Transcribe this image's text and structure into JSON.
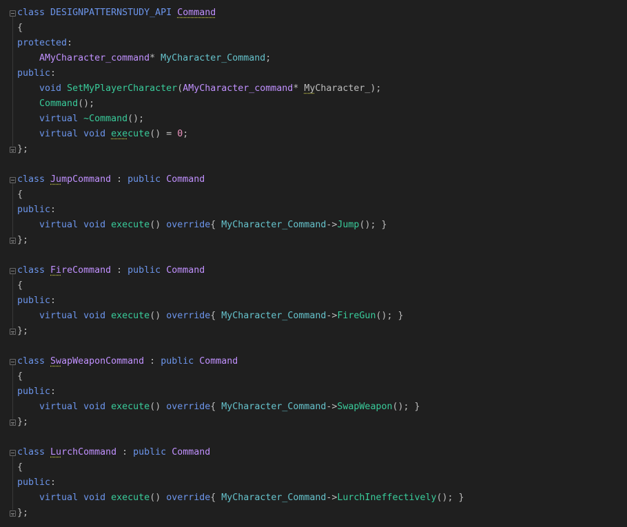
{
  "code": {
    "language": "C++",
    "lines": [
      [
        {
          "t": "class",
          "c": "kw"
        },
        {
          "t": " ",
          "c": "pn"
        },
        {
          "t": "DESIGNPATTERNSTUDY_API",
          "c": "macro"
        },
        {
          "t": " ",
          "c": "pn"
        },
        {
          "t": "Command",
          "c": "cls",
          "sq": 1
        }
      ],
      [
        {
          "t": "{",
          "c": "pn"
        }
      ],
      [
        {
          "t": "protected",
          "c": "kw"
        },
        {
          "t": ":",
          "c": "pn"
        }
      ],
      [
        {
          "t": "    ",
          "c": "pn"
        },
        {
          "t": "AMyCharacter_command",
          "c": "cls"
        },
        {
          "t": "* ",
          "c": "pn"
        },
        {
          "t": "MyCharacter_Command",
          "c": "field"
        },
        {
          "t": ";",
          "c": "pn"
        }
      ],
      [
        {
          "t": "public",
          "c": "kw"
        },
        {
          "t": ":",
          "c": "pn"
        }
      ],
      [
        {
          "t": "    ",
          "c": "pn"
        },
        {
          "t": "void",
          "c": "kw"
        },
        {
          "t": " ",
          "c": "pn"
        },
        {
          "t": "SetMyPlayerCharacter",
          "c": "fn"
        },
        {
          "t": "(",
          "c": "pn"
        },
        {
          "t": "AMyCharacter_command",
          "c": "cls"
        },
        {
          "t": "* ",
          "c": "pn"
        },
        {
          "t": "My",
          "c": "pn",
          "sq": 1
        },
        {
          "t": "Character_);",
          "c": "pn"
        }
      ],
      [
        {
          "t": "    ",
          "c": "pn"
        },
        {
          "t": "Command",
          "c": "fn"
        },
        {
          "t": "();",
          "c": "pn"
        }
      ],
      [
        {
          "t": "    ",
          "c": "pn"
        },
        {
          "t": "virtual",
          "c": "kw"
        },
        {
          "t": " ",
          "c": "pn"
        },
        {
          "t": "~Command",
          "c": "fn"
        },
        {
          "t": "();",
          "c": "pn"
        }
      ],
      [
        {
          "t": "    ",
          "c": "pn"
        },
        {
          "t": "virtual",
          "c": "kw"
        },
        {
          "t": " ",
          "c": "pn"
        },
        {
          "t": "void",
          "c": "kw"
        },
        {
          "t": " ",
          "c": "pn"
        },
        {
          "t": "exe",
          "c": "fn",
          "sq": 1
        },
        {
          "t": "cute",
          "c": "fn"
        },
        {
          "t": "() = ",
          "c": "pn"
        },
        {
          "t": "0",
          "c": "num"
        },
        {
          "t": ";",
          "c": "pn"
        }
      ],
      [
        {
          "t": "};",
          "c": "pn"
        }
      ],
      [],
      [
        {
          "t": "class",
          "c": "kw"
        },
        {
          "t": " ",
          "c": "pn"
        },
        {
          "t": "Ju",
          "c": "cls",
          "sq": 1
        },
        {
          "t": "mpCommand",
          "c": "cls"
        },
        {
          "t": " : ",
          "c": "pn"
        },
        {
          "t": "public",
          "c": "kw"
        },
        {
          "t": " ",
          "c": "pn"
        },
        {
          "t": "Command",
          "c": "cls"
        }
      ],
      [
        {
          "t": "{",
          "c": "pn"
        }
      ],
      [
        {
          "t": "public",
          "c": "kw"
        },
        {
          "t": ":",
          "c": "pn"
        }
      ],
      [
        {
          "t": "    ",
          "c": "pn"
        },
        {
          "t": "virtual",
          "c": "kw"
        },
        {
          "t": " ",
          "c": "pn"
        },
        {
          "t": "void",
          "c": "kw"
        },
        {
          "t": " ",
          "c": "pn"
        },
        {
          "t": "execute",
          "c": "fn"
        },
        {
          "t": "() ",
          "c": "pn"
        },
        {
          "t": "override",
          "c": "kw"
        },
        {
          "t": "{ ",
          "c": "pn"
        },
        {
          "t": "MyCharacter_Command",
          "c": "field"
        },
        {
          "t": "->",
          "c": "pn"
        },
        {
          "t": "Jump",
          "c": "fn"
        },
        {
          "t": "(); }",
          "c": "pn"
        }
      ],
      [
        {
          "t": "};",
          "c": "pn"
        }
      ],
      [],
      [
        {
          "t": "class",
          "c": "kw"
        },
        {
          "t": " ",
          "c": "pn"
        },
        {
          "t": "Fi",
          "c": "cls",
          "sq": 1
        },
        {
          "t": "reCommand",
          "c": "cls"
        },
        {
          "t": " : ",
          "c": "pn"
        },
        {
          "t": "public",
          "c": "kw"
        },
        {
          "t": " ",
          "c": "pn"
        },
        {
          "t": "Command",
          "c": "cls"
        }
      ],
      [
        {
          "t": "{",
          "c": "pn"
        }
      ],
      [
        {
          "t": "public",
          "c": "kw"
        },
        {
          "t": ":",
          "c": "pn"
        }
      ],
      [
        {
          "t": "    ",
          "c": "pn"
        },
        {
          "t": "virtual",
          "c": "kw"
        },
        {
          "t": " ",
          "c": "pn"
        },
        {
          "t": "void",
          "c": "kw"
        },
        {
          "t": " ",
          "c": "pn"
        },
        {
          "t": "execute",
          "c": "fn"
        },
        {
          "t": "() ",
          "c": "pn"
        },
        {
          "t": "override",
          "c": "kw"
        },
        {
          "t": "{ ",
          "c": "pn"
        },
        {
          "t": "MyCharacter_Command",
          "c": "field"
        },
        {
          "t": "->",
          "c": "pn"
        },
        {
          "t": "FireGun",
          "c": "fn"
        },
        {
          "t": "(); }",
          "c": "pn"
        }
      ],
      [
        {
          "t": "};",
          "c": "pn"
        }
      ],
      [],
      [
        {
          "t": "class",
          "c": "kw"
        },
        {
          "t": " ",
          "c": "pn"
        },
        {
          "t": "Sw",
          "c": "cls",
          "sq": 1
        },
        {
          "t": "apWeaponCommand",
          "c": "cls"
        },
        {
          "t": " : ",
          "c": "pn"
        },
        {
          "t": "public",
          "c": "kw"
        },
        {
          "t": " ",
          "c": "pn"
        },
        {
          "t": "Command",
          "c": "cls"
        }
      ],
      [
        {
          "t": "{",
          "c": "pn"
        }
      ],
      [
        {
          "t": "public",
          "c": "kw"
        },
        {
          "t": ":",
          "c": "pn"
        }
      ],
      [
        {
          "t": "    ",
          "c": "pn"
        },
        {
          "t": "virtual",
          "c": "kw"
        },
        {
          "t": " ",
          "c": "pn"
        },
        {
          "t": "void",
          "c": "kw"
        },
        {
          "t": " ",
          "c": "pn"
        },
        {
          "t": "execute",
          "c": "fn"
        },
        {
          "t": "() ",
          "c": "pn"
        },
        {
          "t": "override",
          "c": "kw"
        },
        {
          "t": "{ ",
          "c": "pn"
        },
        {
          "t": "MyCharacter_Command",
          "c": "field"
        },
        {
          "t": "->",
          "c": "pn"
        },
        {
          "t": "SwapWeapon",
          "c": "fn"
        },
        {
          "t": "(); }",
          "c": "pn"
        }
      ],
      [
        {
          "t": "};",
          "c": "pn"
        }
      ],
      [],
      [
        {
          "t": "class",
          "c": "kw"
        },
        {
          "t": " ",
          "c": "pn"
        },
        {
          "t": "Lu",
          "c": "cls",
          "sq": 1
        },
        {
          "t": "rchCommand",
          "c": "cls"
        },
        {
          "t": " : ",
          "c": "pn"
        },
        {
          "t": "public",
          "c": "kw"
        },
        {
          "t": " ",
          "c": "pn"
        },
        {
          "t": "Command",
          "c": "cls"
        }
      ],
      [
        {
          "t": "{",
          "c": "pn"
        }
      ],
      [
        {
          "t": "public",
          "c": "kw"
        },
        {
          "t": ":",
          "c": "pn"
        }
      ],
      [
        {
          "t": "    ",
          "c": "pn"
        },
        {
          "t": "virtual",
          "c": "kw"
        },
        {
          "t": " ",
          "c": "pn"
        },
        {
          "t": "void",
          "c": "kw"
        },
        {
          "t": " ",
          "c": "pn"
        },
        {
          "t": "execute",
          "c": "fn"
        },
        {
          "t": "() ",
          "c": "pn"
        },
        {
          "t": "override",
          "c": "kw"
        },
        {
          "t": "{ ",
          "c": "pn"
        },
        {
          "t": "MyCharacter_Command",
          "c": "field"
        },
        {
          "t": "->",
          "c": "pn"
        },
        {
          "t": "LurchIneffectively",
          "c": "fn"
        },
        {
          "t": "(); }",
          "c": "pn"
        }
      ],
      [
        {
          "t": "};",
          "c": "pn"
        }
      ]
    ],
    "folds": [
      {
        "line": 0,
        "state": "expanded"
      },
      {
        "line": 9,
        "state": "end"
      },
      {
        "line": 11,
        "state": "expanded"
      },
      {
        "line": 15,
        "state": "end"
      },
      {
        "line": 17,
        "state": "expanded"
      },
      {
        "line": 21,
        "state": "end"
      },
      {
        "line": 23,
        "state": "expanded"
      },
      {
        "line": 27,
        "state": "end"
      },
      {
        "line": 29,
        "state": "expanded"
      },
      {
        "line": 33,
        "state": "end"
      }
    ]
  },
  "colors": {
    "background": "#1f1f1f",
    "keyword": "#6c95eb",
    "class": "#c191ff",
    "function": "#39cc9b",
    "field": "#66c3cc",
    "number": "#ed94c0",
    "punctuation": "#bdbdbd"
  }
}
